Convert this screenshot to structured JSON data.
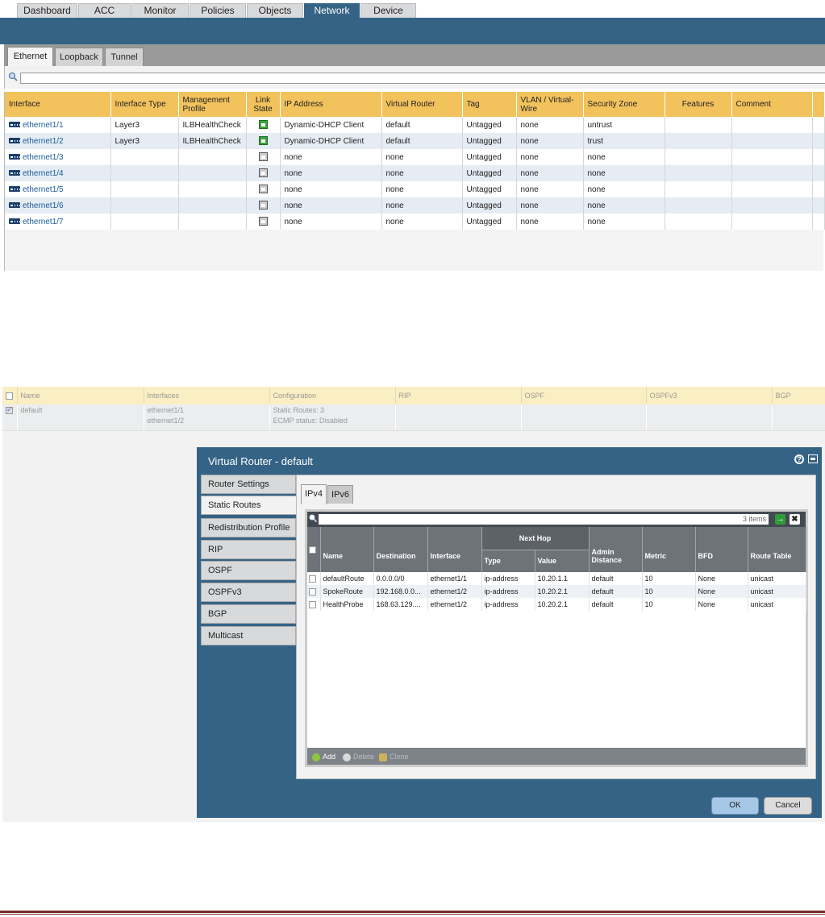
{
  "nav": {
    "tabs": [
      "Dashboard",
      "ACC",
      "Monitor",
      "Policies",
      "Objects",
      "Network",
      "Device"
    ],
    "active": "Network"
  },
  "subtabs": {
    "tabs": [
      "Ethernet",
      "Loopback",
      "Tunnel"
    ],
    "active": "Ethernet"
  },
  "interfaces": {
    "headers": [
      "Interface",
      "Interface Type",
      "Management Profile",
      "Link State",
      "IP Address",
      "Virtual Router",
      "Tag",
      "VLAN / Virtual-Wire",
      "Security Zone",
      "Features",
      "Comment"
    ],
    "rows": [
      {
        "name": "ethernet1/1",
        "type": "Layer3",
        "profile": "ILBHealthCheck",
        "link": "up",
        "ip": "Dynamic-DHCP Client",
        "vr": "default",
        "tag": "Untagged",
        "vlan": "none",
        "zone": "untrust",
        "features": "",
        "comment": ""
      },
      {
        "name": "ethernet1/2",
        "type": "Layer3",
        "profile": "ILBHealthCheck",
        "link": "up",
        "ip": "Dynamic-DHCP Client",
        "vr": "default",
        "tag": "Untagged",
        "vlan": "none",
        "zone": "trust",
        "features": "",
        "comment": ""
      },
      {
        "name": "ethernet1/3",
        "type": "",
        "profile": "",
        "link": "down",
        "ip": "none",
        "vr": "none",
        "tag": "Untagged",
        "vlan": "none",
        "zone": "none",
        "features": "",
        "comment": ""
      },
      {
        "name": "ethernet1/4",
        "type": "",
        "profile": "",
        "link": "down",
        "ip": "none",
        "vr": "none",
        "tag": "Untagged",
        "vlan": "none",
        "zone": "none",
        "features": "",
        "comment": ""
      },
      {
        "name": "ethernet1/5",
        "type": "",
        "profile": "",
        "link": "down",
        "ip": "none",
        "vr": "none",
        "tag": "Untagged",
        "vlan": "none",
        "zone": "none",
        "features": "",
        "comment": ""
      },
      {
        "name": "ethernet1/6",
        "type": "",
        "profile": "",
        "link": "down",
        "ip": "none",
        "vr": "none",
        "tag": "Untagged",
        "vlan": "none",
        "zone": "none",
        "features": "",
        "comment": ""
      },
      {
        "name": "ethernet1/7",
        "type": "",
        "profile": "",
        "link": "down",
        "ip": "none",
        "vr": "none",
        "tag": "Untagged",
        "vlan": "none",
        "zone": "none",
        "features": "",
        "comment": ""
      }
    ]
  },
  "vrouters": {
    "headers": [
      "Name",
      "Interfaces",
      "Configuration",
      "RIP",
      "OSPF",
      "OSPFv3",
      "BGP"
    ],
    "row": {
      "name": "default",
      "interfaces": [
        "ethernet1/1",
        "ethernet1/2"
      ],
      "config": [
        "Static Routes: 3",
        "ECMP status: Disabled"
      ]
    }
  },
  "dialog": {
    "title": "Virtual Router - default",
    "help": "?",
    "sidebar": [
      "Router Settings",
      "Static Routes",
      "Redistribution Profile",
      "RIP",
      "OSPF",
      "OSPFv3",
      "BGP",
      "Multicast"
    ],
    "active_side": "Static Routes",
    "tabs": [
      "IPv4",
      "IPv6"
    ],
    "active_tab": "IPv4",
    "items_count": "3 items",
    "group_header": "Next Hop",
    "headers": [
      "Name",
      "Destination",
      "Interface",
      "Type",
      "Value",
      "Admin Distance",
      "Metric",
      "BFD",
      "Route Table"
    ],
    "routes": [
      {
        "name": "defaultRoute",
        "dest": "0.0.0.0/0",
        "iface": "ethernet1/1",
        "type": "ip-address",
        "value": "10.20.1.1",
        "admin": "default",
        "metric": "10",
        "bfd": "None",
        "table": "unicast"
      },
      {
        "name": "SpokeRoute",
        "dest": "192.168.0.0...",
        "iface": "ethernet1/2",
        "type": "ip-address",
        "value": "10.20.2.1",
        "admin": "default",
        "metric": "10",
        "bfd": "None",
        "table": "unicast"
      },
      {
        "name": "HealthProbe",
        "dest": "168.63.129....",
        "iface": "ethernet1/2",
        "type": "ip-address",
        "value": "10.20.2.1",
        "admin": "default",
        "metric": "10",
        "bfd": "None",
        "table": "unicast"
      }
    ],
    "footer": {
      "add": "Add",
      "delete": "Delete",
      "clone": "Clone"
    },
    "ok": "OK",
    "cancel": "Cancel"
  },
  "colors": {
    "brand_blue": "#356386",
    "header_gold": "#f2c25c",
    "link_blue": "#1b5c96",
    "link_up": "#3ca23c"
  }
}
